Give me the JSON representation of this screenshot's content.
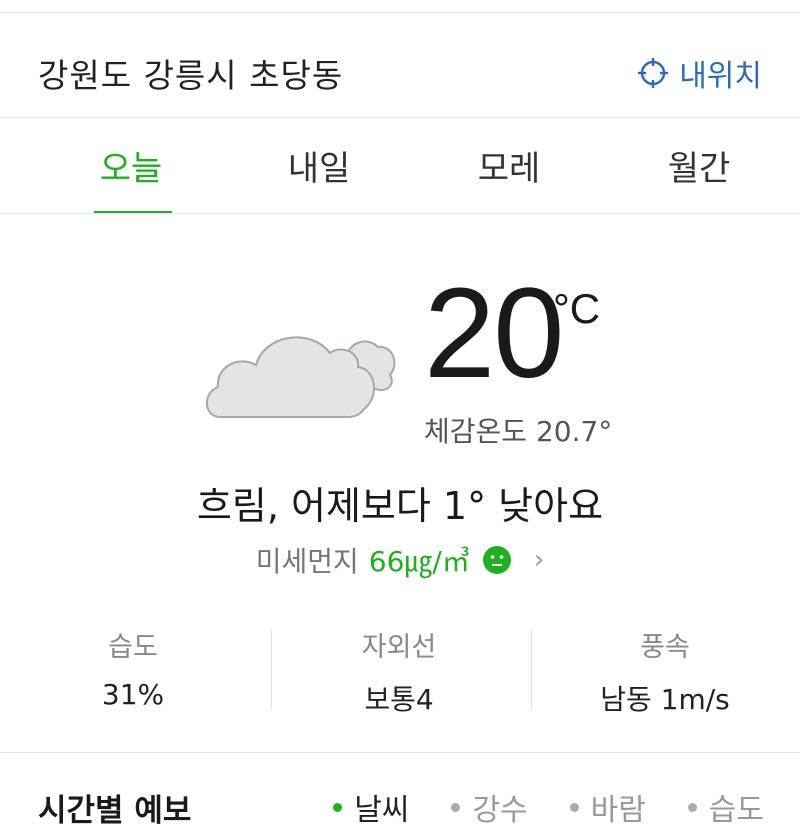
{
  "header": {
    "location": "강원도 강릉시 초당동",
    "my_location_label": "내위치"
  },
  "tabs": [
    {
      "label": "오늘",
      "active": true
    },
    {
      "label": "내일",
      "active": false
    },
    {
      "label": "모레",
      "active": false
    },
    {
      "label": "월간",
      "active": false
    }
  ],
  "current": {
    "icon": "cloudy-icon",
    "temperature": "20",
    "unit": "°C",
    "feels_like": "체감온도 20.7°",
    "summary": "흐림, 어제보다  1° 낮아요"
  },
  "fine_dust": {
    "label": "미세먼지",
    "value": "66㎍/㎥",
    "status_icon": "neutral-face-icon",
    "color": "#1eb11e"
  },
  "stats": [
    {
      "label": "습도",
      "value": "31%"
    },
    {
      "label": "자외선",
      "value": "보통4"
    },
    {
      "label": "풍속",
      "value": "남동 1m/s"
    }
  ],
  "hourly": {
    "title": "시간별 예보",
    "tabs": [
      {
        "label": "날씨",
        "active": true
      },
      {
        "label": "강수",
        "active": false
      },
      {
        "label": "바람",
        "active": false
      },
      {
        "label": "습도",
        "active": false
      }
    ]
  },
  "colors": {
    "accent": "#1eb11e",
    "link": "#2c6bb5"
  }
}
